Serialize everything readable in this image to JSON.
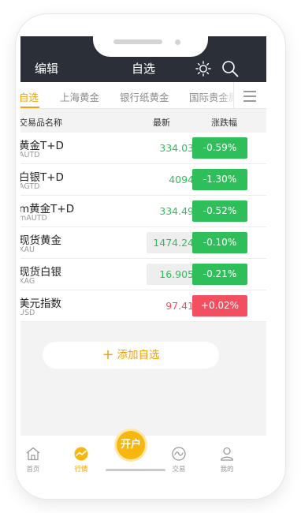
{
  "header": {
    "edit_label": "编辑",
    "title": "自选",
    "icons": [
      "sun-icon",
      "search-icon"
    ]
  },
  "tabs": [
    {
      "label": "自选",
      "active": true
    },
    {
      "label": "上海黄金",
      "active": false
    },
    {
      "label": "银行纸黄金",
      "active": false
    },
    {
      "label": "国际贵金属",
      "active": false
    }
  ],
  "columns": {
    "name": "交易品名称",
    "price": "最新",
    "change": "涨跌幅"
  },
  "colors": {
    "up": "#2fbf5a",
    "down": "#f25060",
    "accent": "#f2a20c",
    "header_bg": "#2b3038"
  },
  "rows": [
    {
      "name": "黄金T+D",
      "code": "AUTD",
      "price": "334.03",
      "change": "-0.59%",
      "direction": "down_green",
      "price_boxed": false
    },
    {
      "name": "白银T+D",
      "code": "AGTD",
      "price": "4094",
      "change": "-1.30%",
      "direction": "down_green",
      "price_boxed": false
    },
    {
      "name": "m黄金T+D",
      "code": "mAUTD",
      "price": "334.49",
      "change": "-0.52%",
      "direction": "down_green",
      "price_boxed": false
    },
    {
      "name": "现货黄金",
      "code": "XAU",
      "price": "1474.24",
      "change": "-0.10%",
      "direction": "down_green",
      "price_boxed": true
    },
    {
      "name": "现货白银",
      "code": "XAG",
      "price": "16.905",
      "change": "-0.21%",
      "direction": "down_green",
      "price_boxed": true
    },
    {
      "name": "美元指数",
      "code": "USD",
      "price": "97.41",
      "change": "+0.02%",
      "direction": "up_red",
      "price_boxed": false
    }
  ],
  "add_button": {
    "plus": "+",
    "label": "添加自选"
  },
  "tabbar": {
    "home": "首页",
    "market": "行情",
    "open_account": "开户",
    "trade": "交易",
    "mine": "我的"
  }
}
